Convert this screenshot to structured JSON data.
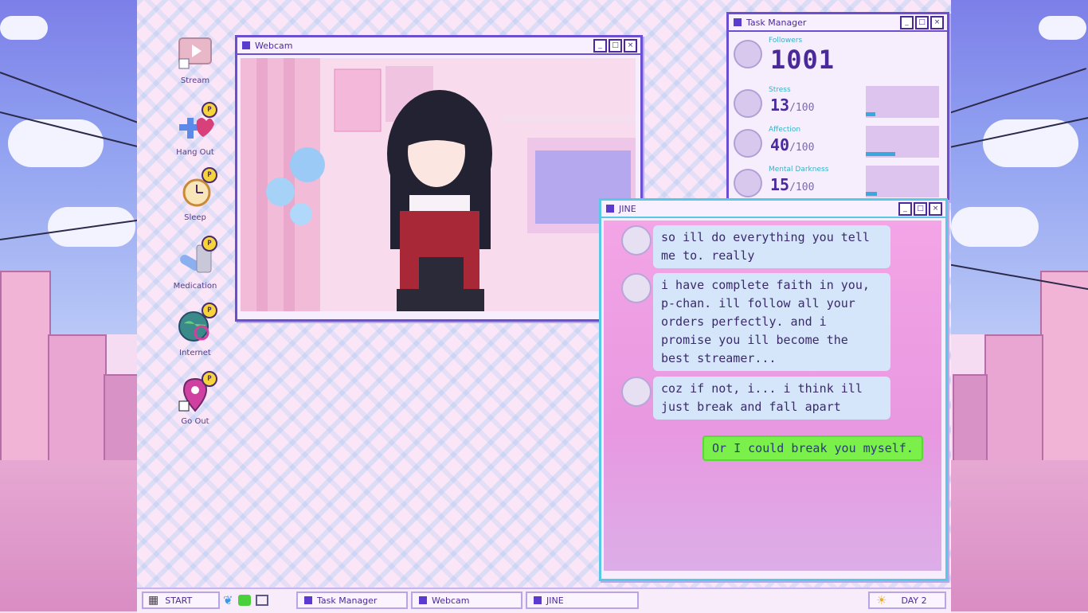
{
  "desktop_icons": [
    {
      "label": "Stream",
      "icon": "stream-icon",
      "badge": ""
    },
    {
      "label": "Hang Out",
      "icon": "hang-out-icon",
      "badge": "P"
    },
    {
      "label": "Sleep",
      "icon": "sleep-clock-icon",
      "badge": "P"
    },
    {
      "label": "Medication",
      "icon": "medication-icon",
      "badge": "P"
    },
    {
      "label": "Internet",
      "icon": "internet-globe-icon",
      "badge": "P"
    },
    {
      "label": "Go Out",
      "icon": "go-out-pin-icon",
      "badge": "P"
    }
  ],
  "webcam": {
    "title": "Webcam"
  },
  "task_manager": {
    "title": "Task Manager",
    "followers_label": "Followers",
    "followers_value": "1001",
    "stats": [
      {
        "label": "Stress",
        "value": "13",
        "max": "/100",
        "fraction": 0.13
      },
      {
        "label": "Affection",
        "value": "40",
        "max": "/100",
        "fraction": 0.4
      },
      {
        "label": "Mental Darkness",
        "value": "15",
        "max": "/100",
        "fraction": 0.15
      }
    ]
  },
  "jine": {
    "title": "JINE",
    "messages": [
      {
        "text": "so ill do everything you tell me to. really"
      },
      {
        "text": "i have complete faith in you, p-chan. ill follow all your orders perfectly. and i promise you ill become the best streamer..."
      },
      {
        "text": "coz if not, i... i think ill just break and fall apart"
      }
    ],
    "reply": "Or I could break you myself."
  },
  "taskbar": {
    "start_label": "START",
    "tasks": [
      "Task Manager",
      "Webcam",
      "JINE"
    ],
    "day_label": "DAY 2"
  },
  "colors": {
    "accent": "#6a4fd0",
    "chat_bubble": "#d5e6fb",
    "reply_bubble": "#7cf04a",
    "stat_fill": "#3aa8dc"
  }
}
